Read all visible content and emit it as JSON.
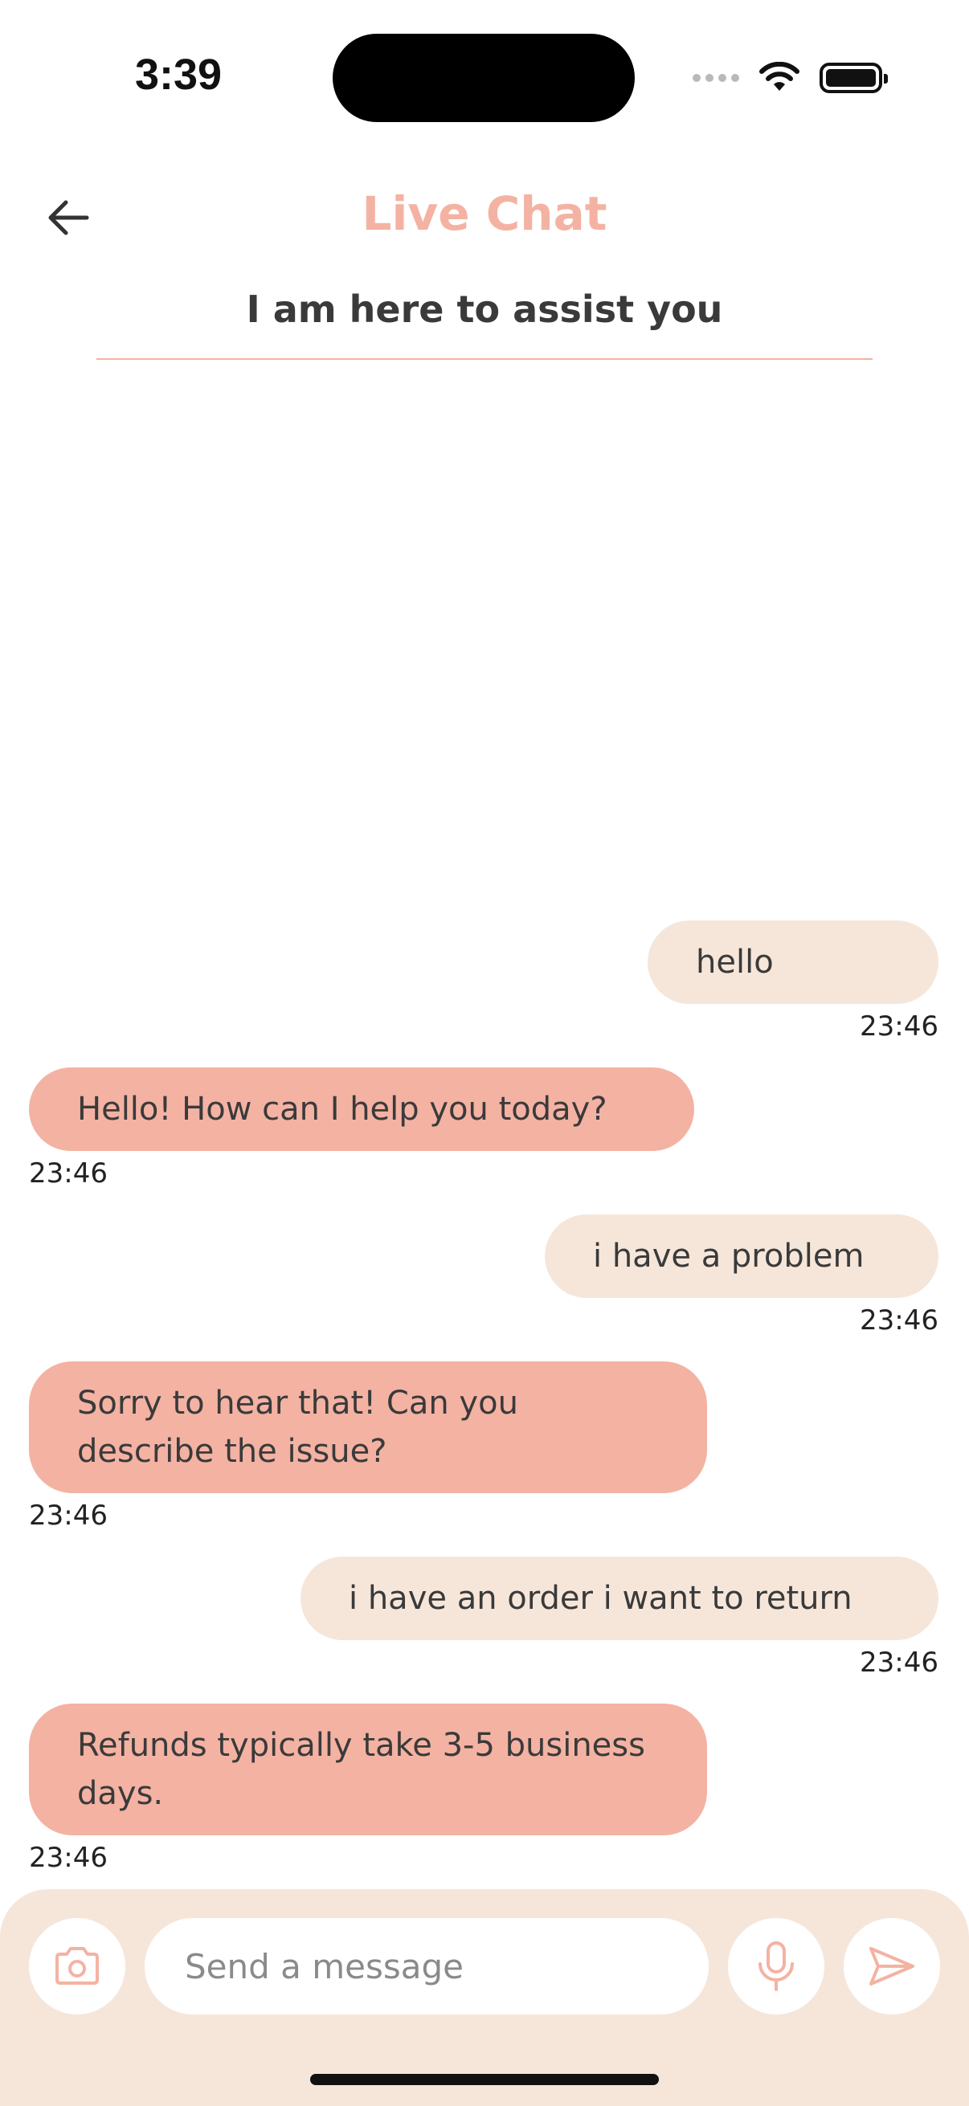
{
  "status_bar": {
    "time": "3:39"
  },
  "header": {
    "title": "Live Chat",
    "subtitle": "I am here to assist you"
  },
  "messages": [
    {
      "sender": "user",
      "text": "hello",
      "time": "23:46"
    },
    {
      "sender": "bot",
      "text": "Hello! How can I help you today?",
      "time": "23:46"
    },
    {
      "sender": "user",
      "text": "i have a problem",
      "time": "23:46"
    },
    {
      "sender": "bot",
      "text": "Sorry to hear that! Can you describe the issue?",
      "time": "23:46"
    },
    {
      "sender": "user",
      "text": "i have an order i want to return",
      "time": "23:46"
    },
    {
      "sender": "bot",
      "text": "Refunds typically take 3-5 business days.",
      "time": "23:46"
    }
  ],
  "composer": {
    "placeholder": "Send a message",
    "value": ""
  },
  "icons": {
    "back": "arrow-left-icon",
    "camera": "camera-icon",
    "mic": "microphone-icon",
    "send": "send-icon"
  },
  "colors": {
    "accent": "#f4b2a3",
    "user_bubble": "#f6e6da",
    "bot_bubble": "#f4b2a3",
    "text": "#3a3a3a"
  }
}
